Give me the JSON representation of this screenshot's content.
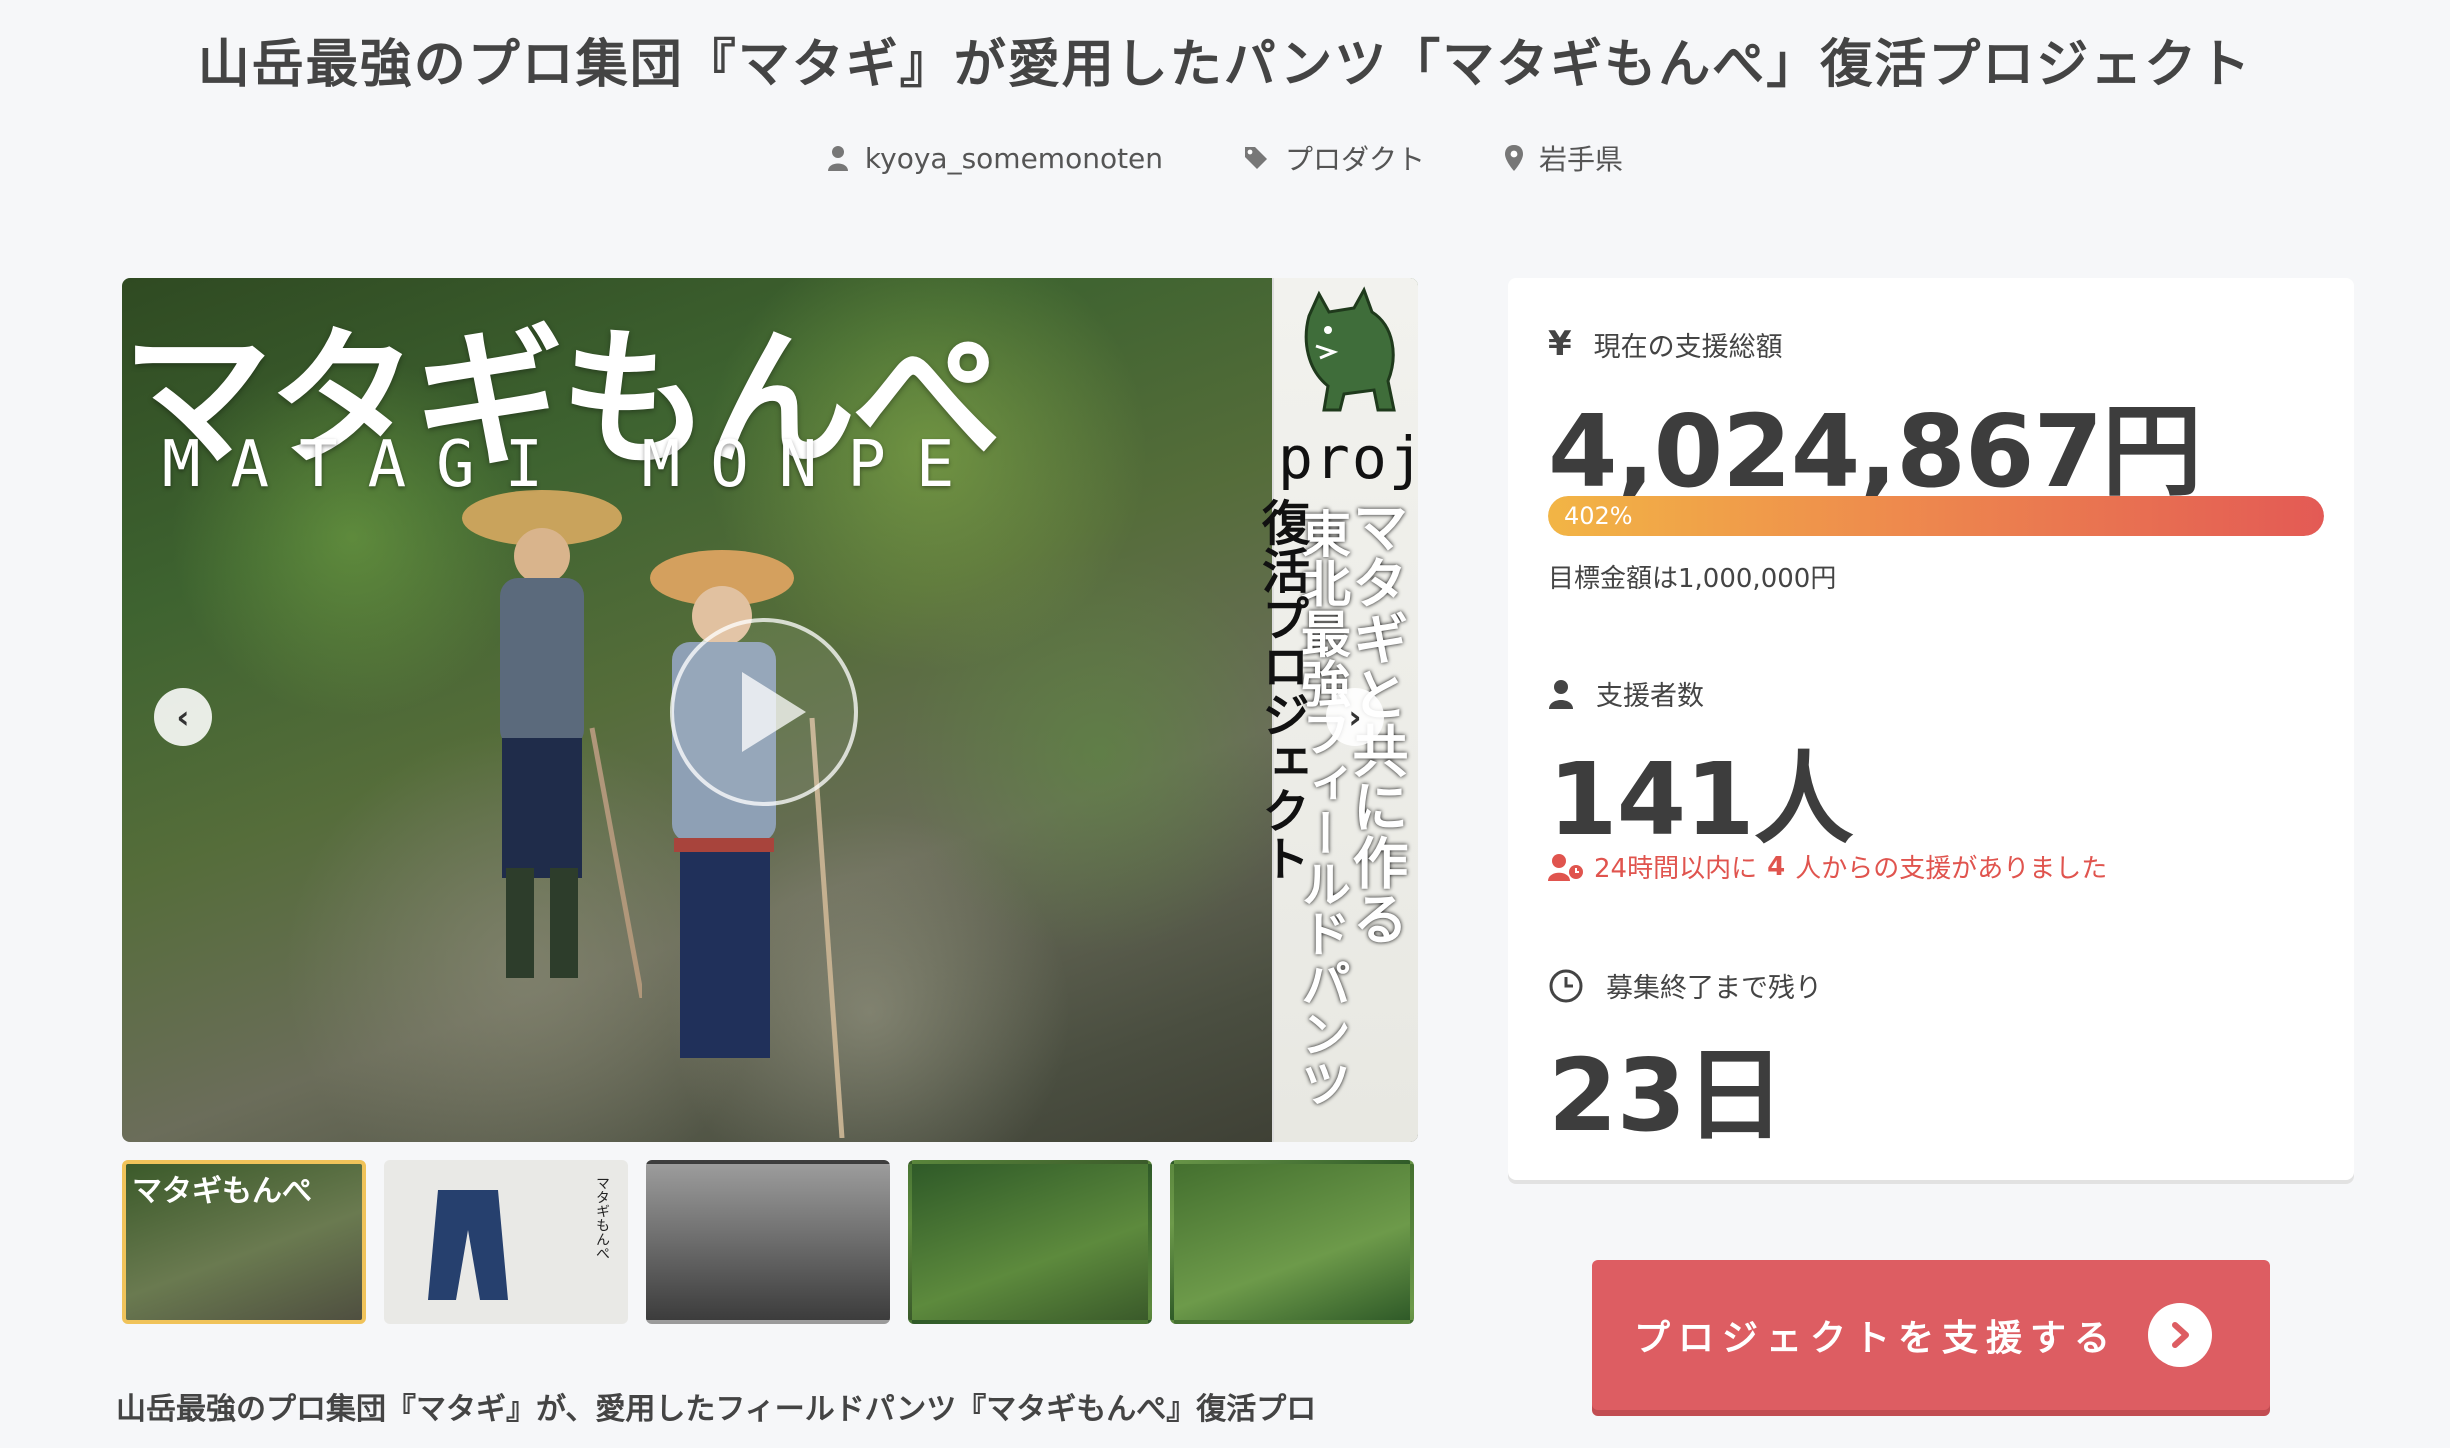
{
  "page": {
    "title": "山岳最強のプロ集団『マタギ』が愛用したパンツ「マタギもんぺ」復活プロジェクト",
    "meta": {
      "author": "kyoya_somemonoten",
      "category": "プロダクト",
      "location": "岩手県"
    }
  },
  "hero": {
    "title_jp": "マタギもんぺ",
    "title_en": "MATAGI MONPE",
    "project": "project",
    "vertical_1": "マタギと共に作る",
    "vertical_2": "東北最強フィールドパンツ",
    "vertical_3": "復活プロジェクト",
    "prev_arrow": "‹",
    "next_arrow": "›"
  },
  "thumbnails": [
    {
      "label": "マタギもんぺ"
    },
    {
      "label": "マタギもんぺ"
    },
    {
      "label": ""
    },
    {
      "label": ""
    },
    {
      "label": ""
    }
  ],
  "description": "山岳最強のプロ集団『マタギ』が、愛用したフィールドパンツ『マタギもんぺ』復活プロ",
  "stats": {
    "amount_label": "現在の支援総額",
    "amount_value": "4,024,867円",
    "progress_label": "402%",
    "progress_percent": 100,
    "goal_text": "目標金額は1,000,000円",
    "backers_label": "支援者数",
    "backers_value": "141人",
    "recent_prefix": "24時間以内に",
    "recent_count": "4",
    "recent_suffix": "人からの支援がありました",
    "remaining_label": "募集終了まで残り",
    "remaining_value": "23日"
  },
  "cta": {
    "label": "プロジェクトを支援する"
  },
  "colors": {
    "accent": "#dd5d62",
    "recent": "#e0544e",
    "thumb_active": "#f0c35a"
  }
}
